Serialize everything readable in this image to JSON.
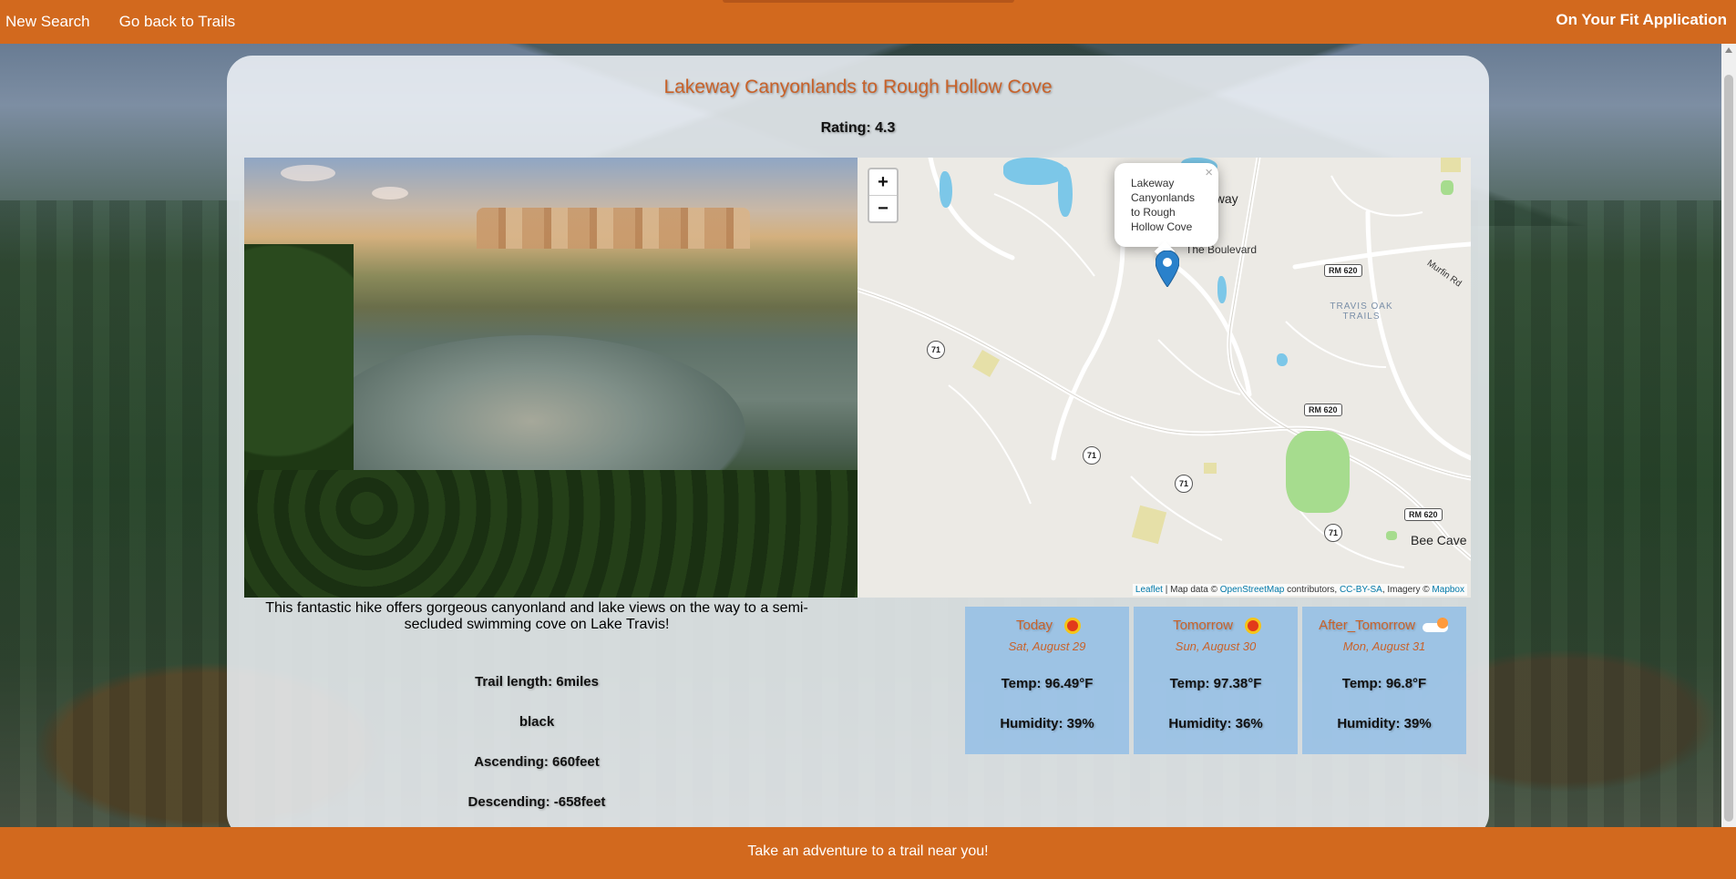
{
  "nav": {
    "new_search": "New Search",
    "back_to_trails": "Go back to Trails",
    "brand": "On Your Fit Application"
  },
  "trail": {
    "name": "Lakeway Canyonlands to Rough Hollow Cove",
    "rating": "Rating: 4.3",
    "length": "Trail length: 6miles",
    "difficulty": "black",
    "ascending": "Ascending: 660feet",
    "descending": "Descending: -658feet",
    "summary": "This fantastic hike offers gorgeous canyonland and lake views on the way to a semi-secluded swimming cove on Lake Travis!"
  },
  "map": {
    "zoom_in": "+",
    "zoom_out": "−",
    "popup_text": "Lakeway Canyonlands to Rough Hollow Cove",
    "popup_close": "×",
    "labels": {
      "lakeway": "away",
      "boulevard": "The Boulevard",
      "murfin": "Murfin Rd",
      "travis_oak": "TRAVIS OAK TRAILS",
      "bee_cave": "Bee Cave"
    },
    "shields": [
      "71",
      "71",
      "71",
      "71",
      "RM 620",
      "RM 620",
      "RM 620"
    ],
    "attribution": {
      "leaflet": "Leaflet",
      "sep1": " | Map data © ",
      "osm": "OpenStreetMap",
      "mid": " contributors, ",
      "ccbysa": "CC-BY-SA",
      "imagery": ", Imagery © ",
      "mapbox": "Mapbox"
    }
  },
  "weather": [
    {
      "day": "Today",
      "date": "Sat, August 29",
      "temp": "Temp: 96.49°F",
      "humidity": "Humidity: 39%",
      "icon": "sun-icon"
    },
    {
      "day": "Tomorrow",
      "date": "Sun, August 30",
      "temp": "Temp: 97.38°F",
      "humidity": "Humidity: 36%",
      "icon": "sun-icon"
    },
    {
      "day": "After_Tomorrow",
      "date": "Mon, August 31",
      "temp": "Temp: 96.8°F",
      "humidity": "Humidity: 39%",
      "icon": "partly-cloudy-icon"
    }
  ],
  "footer": {
    "tagline": "Take an adventure to a trail near you!"
  },
  "colors": {
    "accent": "#d2691e",
    "title": "#c8622a",
    "weather_card": "#88bae8",
    "link": "#0078a8"
  }
}
